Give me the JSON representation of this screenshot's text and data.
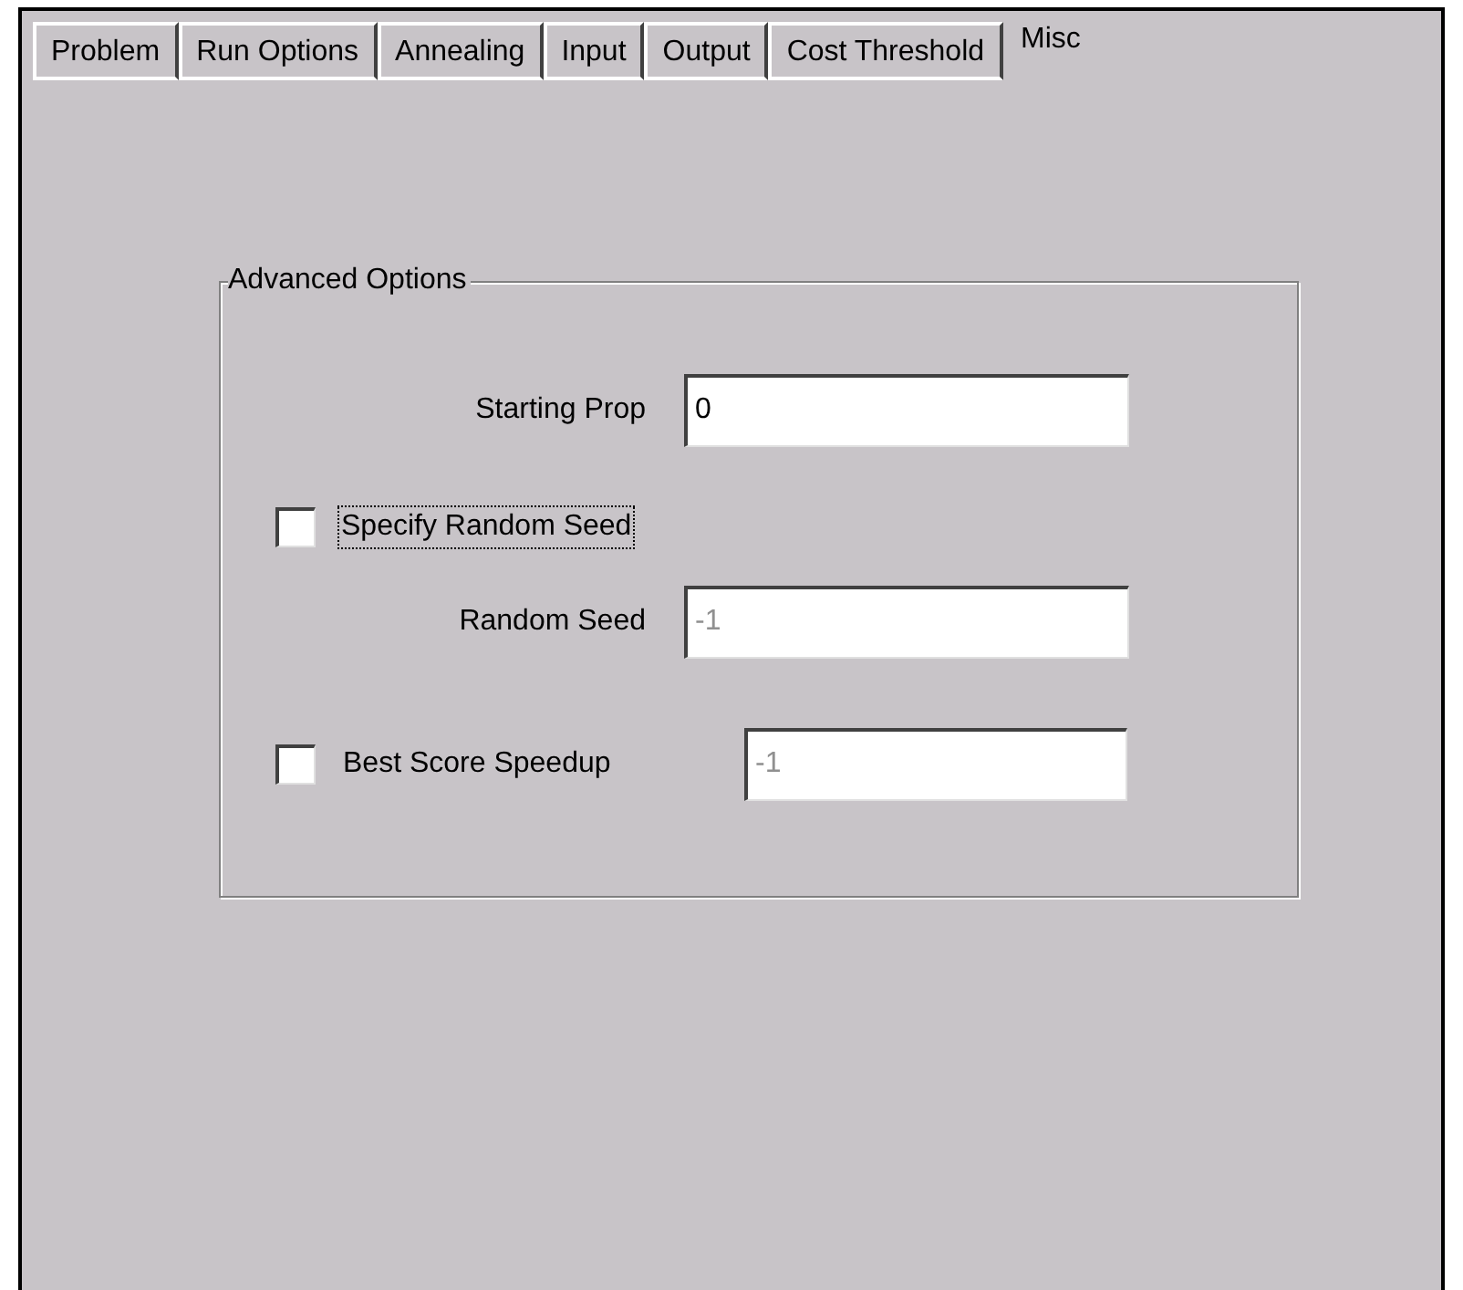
{
  "tabs": [
    {
      "label": "Problem",
      "selected": false
    },
    {
      "label": "Run Options",
      "selected": false
    },
    {
      "label": "Annealing",
      "selected": false
    },
    {
      "label": "Input",
      "selected": false
    },
    {
      "label": "Output",
      "selected": false
    },
    {
      "label": "Cost Threshold",
      "selected": false
    },
    {
      "label": "Misc",
      "selected": true
    }
  ],
  "group": {
    "title": "Advanced Options",
    "rows": [
      {
        "kind": "field",
        "label": "Starting Prop",
        "value": "0",
        "disabled": false
      },
      {
        "kind": "checkbox",
        "label": "Specify Random Seed",
        "checked": false,
        "focused": true
      },
      {
        "kind": "field",
        "label": "Random Seed",
        "value": "-1",
        "disabled": true
      },
      {
        "kind": "checkbox_field",
        "label": "Best Score Speedup",
        "checked": false,
        "value": "-1",
        "disabled": true
      }
    ]
  }
}
